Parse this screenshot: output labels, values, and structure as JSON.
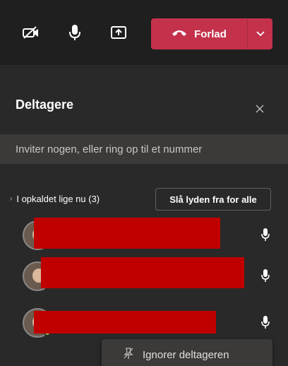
{
  "toolbar": {
    "camera_icon": "camera-off-icon",
    "mic_icon": "microphone-icon",
    "share_icon": "share-screen-icon",
    "leave_label": "Forlad",
    "leave_color": "#c4314b"
  },
  "panel": {
    "title": "Deltagere",
    "invite_placeholder": "Inviter nogen, eller ring op til et nummer",
    "section_label": "I opkaldet lige nu (3)",
    "mute_all_label": "Slå lyden fra for alle"
  },
  "participants": [
    {
      "status_color": "#92c353"
    },
    {
      "status_color": "#c4314b"
    },
    {
      "status_color": "#92c353"
    }
  ],
  "tooltip": {
    "label": "Ignorer deltageren",
    "icon": "unpin-icon"
  },
  "colors": {
    "background": "#292929",
    "toolbar": "#1f1f1f",
    "redaction": "#c00000"
  }
}
